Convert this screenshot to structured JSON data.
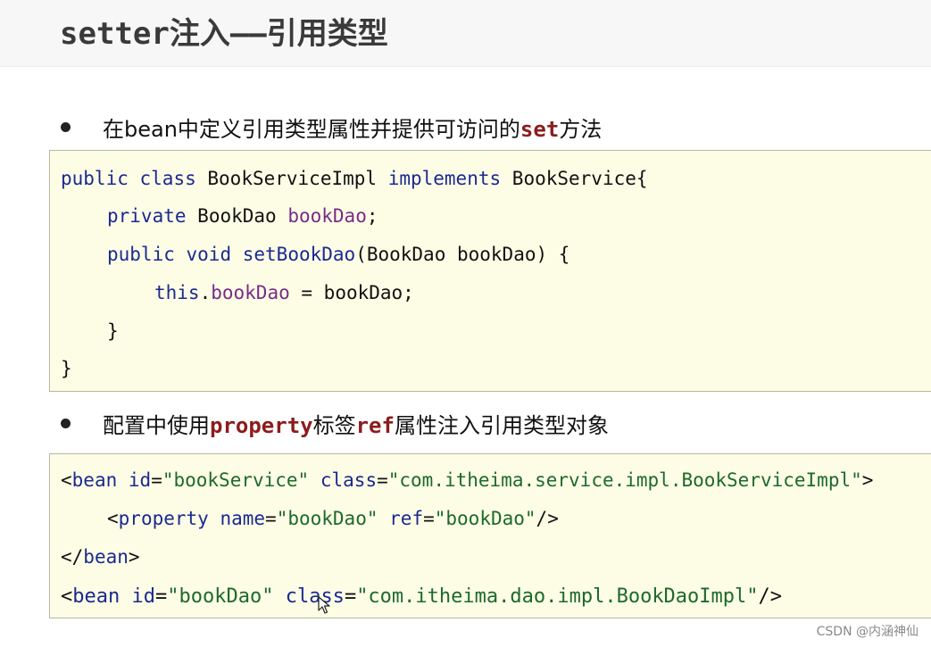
{
  "title": "setter注入——引用类型",
  "bullet1": {
    "before": "在bean中定义引用类型属性并提供可访问的",
    "keyword": "set",
    "after": "方法"
  },
  "code1": {
    "line1": {
      "kw_public": "public",
      "kw_class": "class",
      "classname": "BookServiceImpl",
      "kw_implements": "implements",
      "iface": "BookService{"
    },
    "line2": {
      "kw_private": "private",
      "type": "BookDao",
      "field": "bookDao",
      "semi": ";"
    },
    "line3": {
      "kw_public": "public",
      "kw_void": "void",
      "method": "setBookDao",
      "params": "(BookDao bookDao) {"
    },
    "line4": {
      "kw_this": "this",
      "dot": ".",
      "field": "bookDao",
      "rest": " = bookDao;"
    },
    "line5": "}",
    "line6": "}"
  },
  "bullet2": {
    "before": "配置中使用",
    "keyword1": "property",
    "middle": "标签",
    "keyword2": "ref",
    "after": "属性注入引用类型对象"
  },
  "code2": {
    "line1": {
      "lt": "<",
      "tag": "bean",
      "attr_id": "id",
      "eq1": "=",
      "val_id": "\"bookService\"",
      "attr_class": "class",
      "eq2": "=",
      "val_class": "\"com.itheima.service.impl.BookServiceImpl\"",
      "gt": ">"
    },
    "line2": {
      "lt": "<",
      "tag": "property",
      "attr_name": "name",
      "eq1": "=",
      "val_name": "\"bookDao\"",
      "attr_ref": "ref",
      "eq2": "=",
      "val_ref": "\"bookDao\"",
      "end": "/>"
    },
    "line3": {
      "lt": "</",
      "tag": "bean",
      "gt": ">"
    },
    "line4": {
      "lt": "<",
      "tag": "bean",
      "attr_id": "id",
      "eq1": "=",
      "val_id": "\"bookDao\"",
      "attr_class": "class",
      "eq2": "=",
      "val_class": "\"com.itheima.dao.impl.BookDaoImpl\"",
      "end": "/>"
    }
  },
  "watermark": "CSDN @内涵神仙"
}
